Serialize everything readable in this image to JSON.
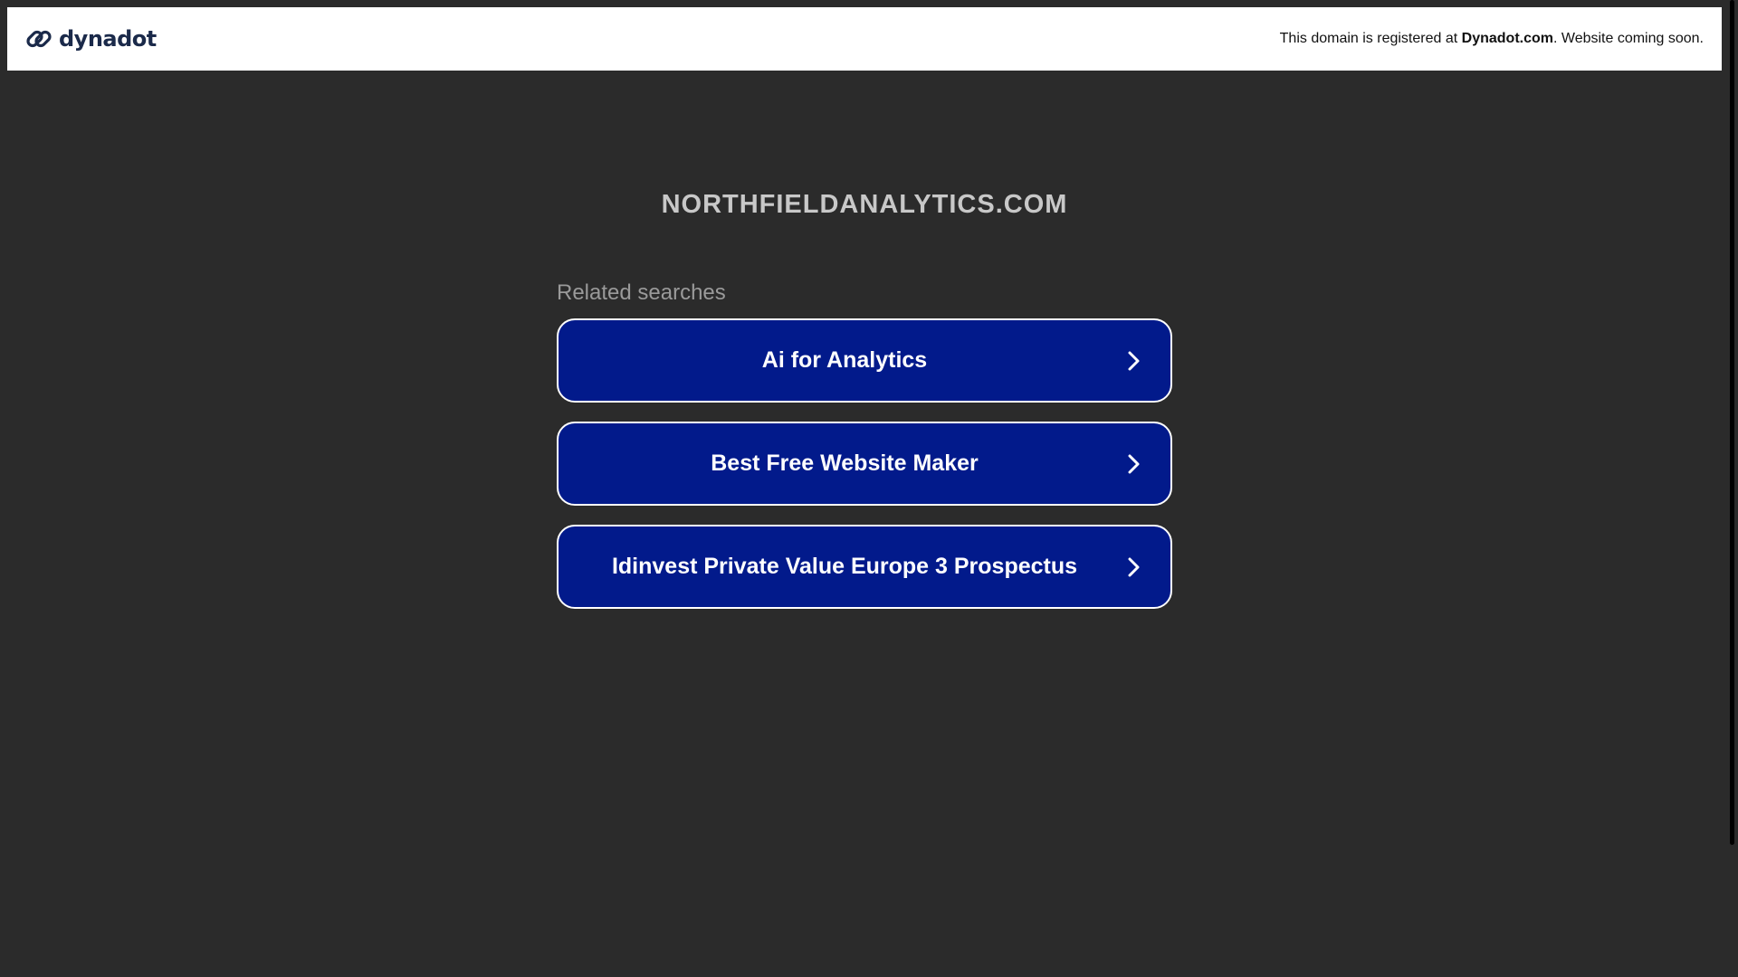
{
  "header": {
    "brand": "dynadot",
    "notice_prefix": "This domain is registered at ",
    "notice_brand": "Dynadot.com",
    "notice_suffix": ". Website coming soon."
  },
  "main": {
    "domain": "NORTHFIELDANALYTICS.COM",
    "related_heading": "Related searches",
    "links": [
      {
        "label": "Ai for Analytics"
      },
      {
        "label": "Best Free Website Maker"
      },
      {
        "label": "Idinvest Private Value Europe 3 Prospectus"
      }
    ]
  },
  "colors": {
    "background": "#2b2b2b",
    "link_button": "#021a8b",
    "header": "#ffffff"
  },
  "icons": {
    "logo": "dynadot-link-logo-icon",
    "link_arrow": "chevron-right-icon"
  }
}
